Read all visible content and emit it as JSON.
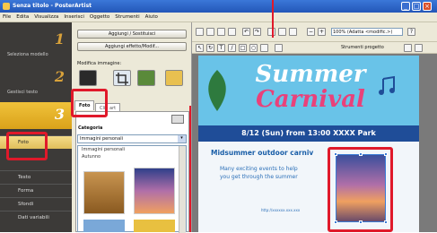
{
  "window": {
    "title": "Senza titolo - PosterArtist"
  },
  "menubar": [
    "File",
    "Edita",
    "Visualizza",
    "Inserisci",
    "Oggetto",
    "Strumenti",
    "Aiuto"
  ],
  "sidebar": {
    "steps": [
      {
        "num": "1",
        "label": "Seleziona modello"
      },
      {
        "num": "2",
        "label": "Gestisci testo"
      },
      {
        "num": "3",
        "label": ""
      }
    ],
    "nav": [
      "Foto",
      "Testo",
      "Forma",
      "Sfondi",
      "Dati variabili"
    ]
  },
  "panel": {
    "add_remove_label": "Aggiungi / Sostituisci",
    "add_photo_label": "Aggiungi effetto/Modif...",
    "modify_label": "Modifica immagine:",
    "tabs": [
      "Foto",
      "Clip art"
    ],
    "category_label": "Categoria",
    "category_value": "Immagini personali",
    "list_items": [
      "Immagini personali",
      "Autunno"
    ]
  },
  "toolbar": {
    "zoom": "100% (Adatta <modific.>)",
    "tools_label": "Strumenti progetto"
  },
  "poster": {
    "line1": "Summer",
    "line2": "Carnival",
    "date": "8/12 (Sun) from 13:00  XXXX Park",
    "headline": "Midsummer outdoor carniv",
    "body1": "Many exciting events to help",
    "body2": "you get through the summer",
    "url": "http://xxxxxx.xxx.xxx"
  },
  "colors": {
    "accent_red": "#e0192a",
    "sidebar": "#3c3a38",
    "gold": "#e0b03a"
  }
}
